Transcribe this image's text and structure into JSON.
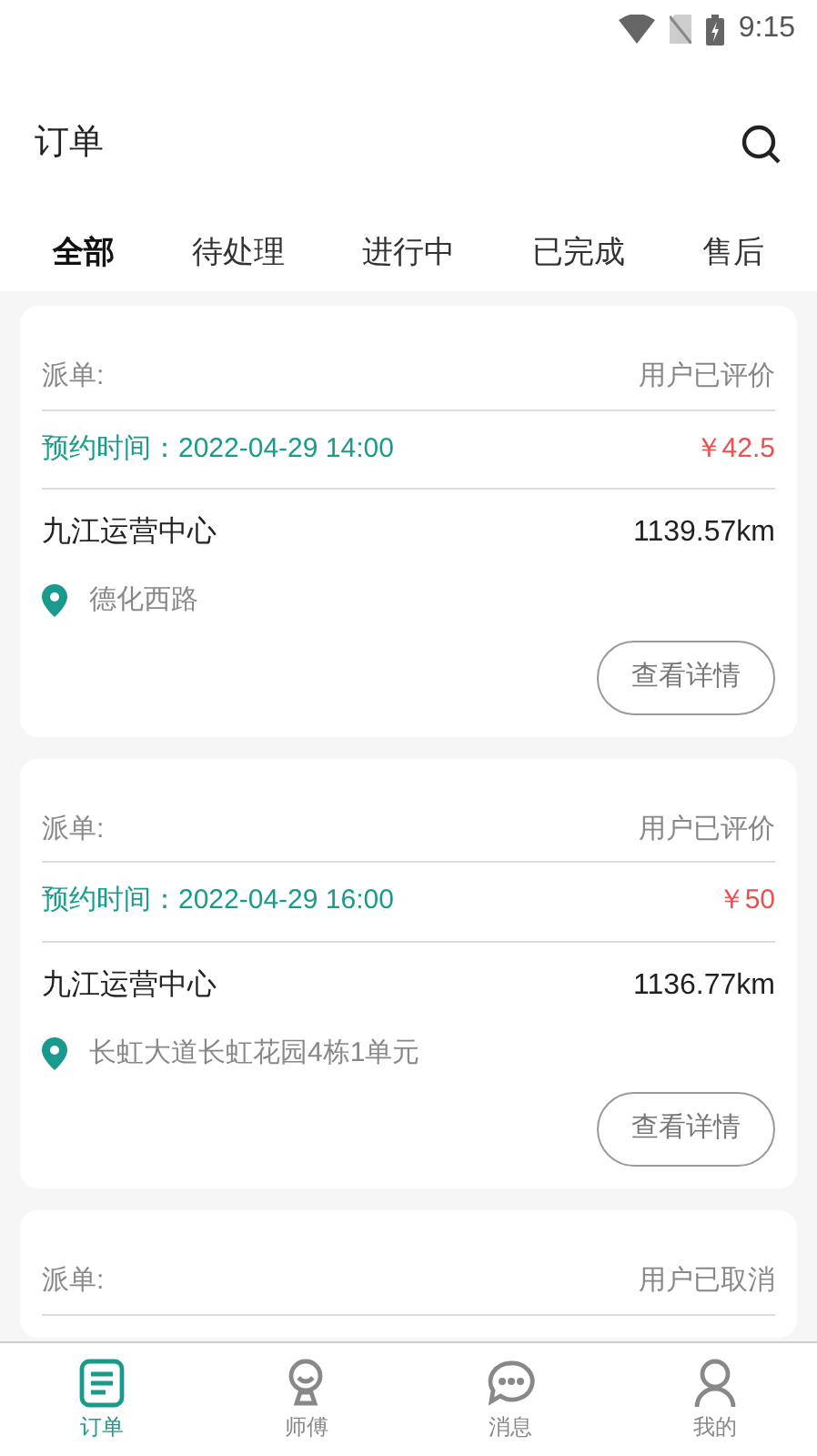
{
  "status_bar": {
    "time": "9:15"
  },
  "header": {
    "title": "订单"
  },
  "tabs": [
    {
      "label": "全部",
      "selected": true
    },
    {
      "label": "待处理",
      "selected": false
    },
    {
      "label": "进行中",
      "selected": false
    },
    {
      "label": "已完成",
      "selected": false
    },
    {
      "label": "售后",
      "selected": false
    }
  ],
  "orders": [
    {
      "dispatch_label": "派单:",
      "status": "用户已评价",
      "appointment": "预约时间：2022-04-29 14:00",
      "price": "￥42.5",
      "station": "九江运营中心",
      "distance": "1139.57km",
      "address": "德化西路",
      "button": "查看详情"
    },
    {
      "dispatch_label": "派单:",
      "status": "用户已评价",
      "appointment": "预约时间：2022-04-29 16:00",
      "price": "￥50",
      "station": "九江运营中心",
      "distance": "1136.77km",
      "address": "长虹大道长虹花园4栋1单元",
      "button": "查看详情"
    },
    {
      "dispatch_label": "派单:",
      "status": "用户已取消"
    }
  ],
  "bottom_nav": [
    {
      "label": "订单",
      "kind": "orders",
      "selected": true
    },
    {
      "label": "师傅",
      "kind": "master",
      "selected": false
    },
    {
      "label": "消息",
      "kind": "messages",
      "selected": false
    },
    {
      "label": "我的",
      "kind": "profile",
      "selected": false
    }
  ]
}
